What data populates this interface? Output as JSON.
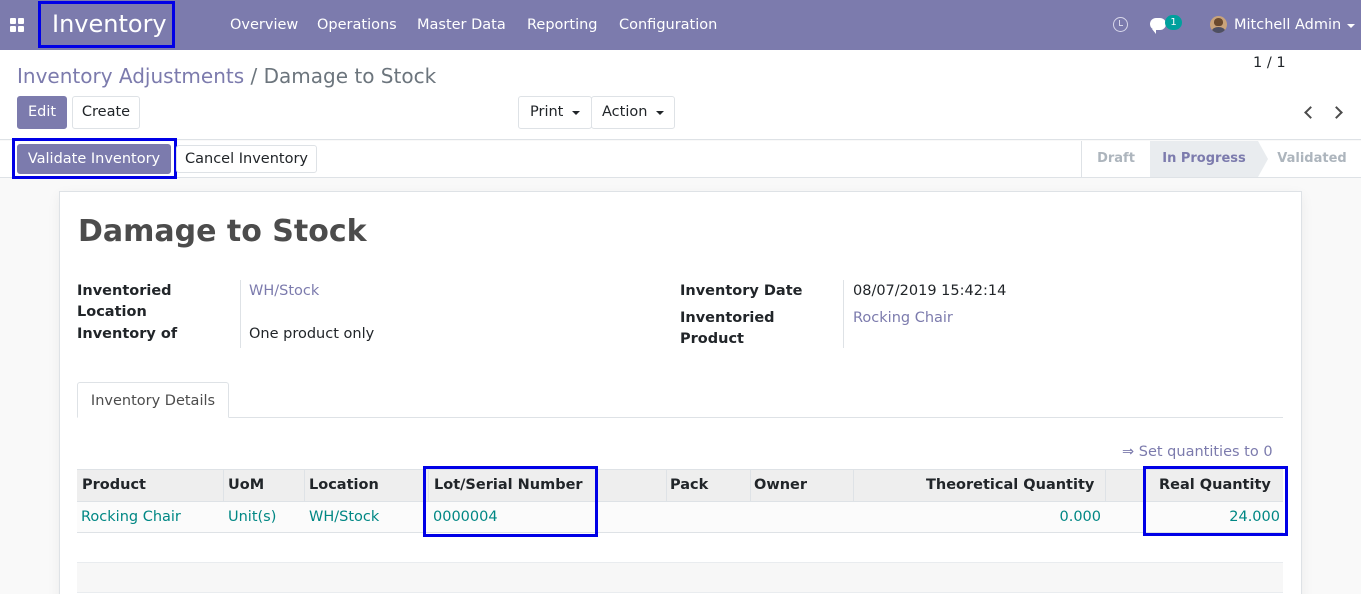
{
  "navbar": {
    "brand": "Inventory",
    "menu": [
      "Overview",
      "Operations",
      "Master Data",
      "Reporting",
      "Configuration"
    ],
    "chat_badge": "1",
    "user": "Mitchell Admin",
    "bg_color": "#7c7bad"
  },
  "breadcrumb": {
    "parent": "Inventory Adjustments",
    "separator": "/",
    "current": "Damage to Stock"
  },
  "buttons": {
    "edit": "Edit",
    "create": "Create",
    "print": "Print",
    "action": "Action",
    "validate": "Validate Inventory",
    "cancel": "Cancel Inventory"
  },
  "pager": {
    "value": "1 / 1"
  },
  "stages": [
    "Draft",
    "In Progress",
    "Validated"
  ],
  "active_stage": "In Progress",
  "form": {
    "title": "Damage to Stock",
    "left": [
      {
        "label": "Inventoried Location",
        "value": "WH/Stock"
      },
      {
        "label": "Inventory of",
        "value": "One product only"
      }
    ],
    "right": [
      {
        "label": "Inventory Date",
        "value": "08/07/2019 15:42:14"
      },
      {
        "label": "Inventoried Product",
        "value": "Rocking Chair"
      }
    ]
  },
  "tabs": [
    "Inventory Details"
  ],
  "set_quantities_link": "⇒ Set quantities to 0",
  "table": {
    "headers": [
      "Product",
      "UoM",
      "Location",
      "Lot/Serial Number",
      "Pack",
      "Owner",
      "Theoretical Quantity",
      "Real Quantity"
    ],
    "rows": [
      {
        "product": "Rocking Chair",
        "uom": "Unit(s)",
        "location": "WH/Stock",
        "lot": "0000004",
        "pack": "",
        "owner": "",
        "theoretical_qty": "0.000",
        "real_qty": "24.000"
      }
    ]
  }
}
